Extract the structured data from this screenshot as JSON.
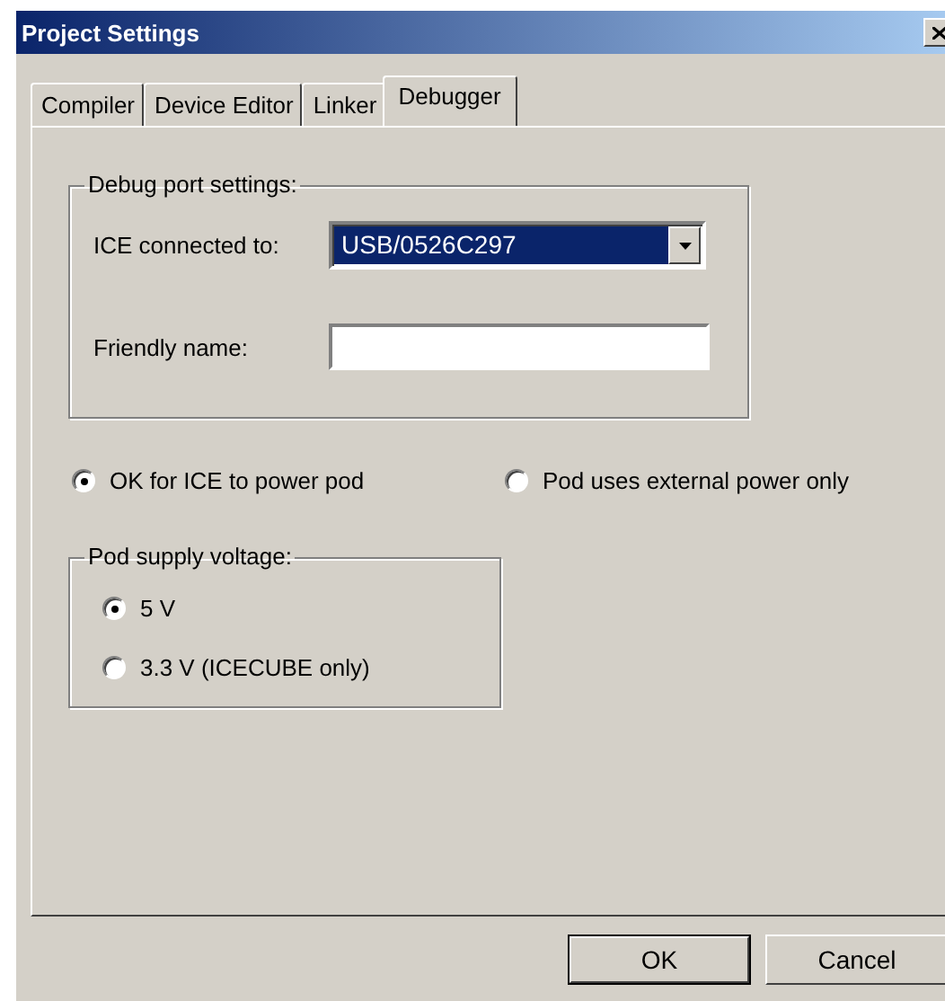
{
  "window": {
    "title": "Project Settings"
  },
  "tabs": [
    {
      "label": "Compiler",
      "selected": false
    },
    {
      "label": "Device Editor",
      "selected": false
    },
    {
      "label": "Linker",
      "selected": false
    },
    {
      "label": "Debugger",
      "selected": true
    }
  ],
  "debug_port_settings": {
    "title": "Debug port settings:",
    "ice_connected_to": {
      "label": "ICE connected to:",
      "value": "USB/0526C297"
    },
    "friendly_name": {
      "label": "Friendly name:"
    }
  },
  "power_options": [
    {
      "label": "OK for ICE to power pod",
      "selected": true
    },
    {
      "label": "Pod uses external power only",
      "selected": false
    }
  ],
  "pod_supply_voltage": {
    "title": "Pod supply voltage:",
    "options": [
      {
        "label": "5 V",
        "selected": true
      },
      {
        "label": "3.3 V (ICECUBE only)",
        "selected": false
      }
    ]
  },
  "buttons": [
    {
      "label": "OK",
      "default": true
    },
    {
      "label": "Cancel",
      "default": false
    }
  ]
}
